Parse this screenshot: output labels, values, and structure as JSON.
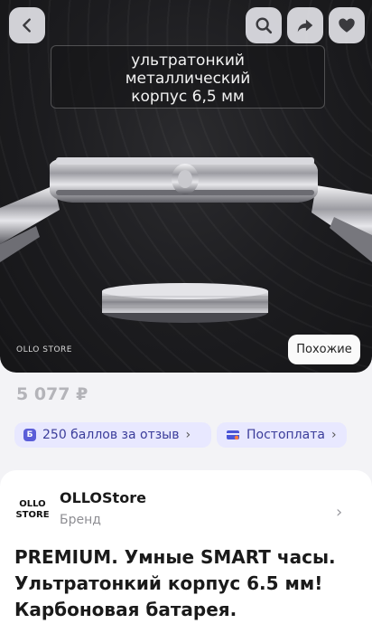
{
  "hero": {
    "caption": "ультратонкий\nметаллический\nкорпус 6,5 мм",
    "brand_mark": "OLLO STORE",
    "similar_label": "Похожие"
  },
  "icons": {
    "back": "chevron-left-icon",
    "search": "search-icon",
    "share": "share-icon",
    "favorite": "heart-icon"
  },
  "price": "5 077 ₽",
  "chips": {
    "reviews_badge": "Б",
    "reviews_label": "250 баллов за отзыв",
    "postpay_label": "Постоплата"
  },
  "store": {
    "logo_line1": "OLLO",
    "logo_line2": "STORE",
    "name": "OLLOStore",
    "subtitle": "Бренд"
  },
  "product": {
    "title": "PREMIUM. Умные SMART часы.\nУльтратонкий корпус 6.5 мм!\nКарбоновая батарея."
  },
  "colors": {
    "hero_bg": "#1c1c1f",
    "chip_bg": "#e8e8ff",
    "chip_text": "#3b3d9a",
    "price": "#b4b4b9"
  }
}
